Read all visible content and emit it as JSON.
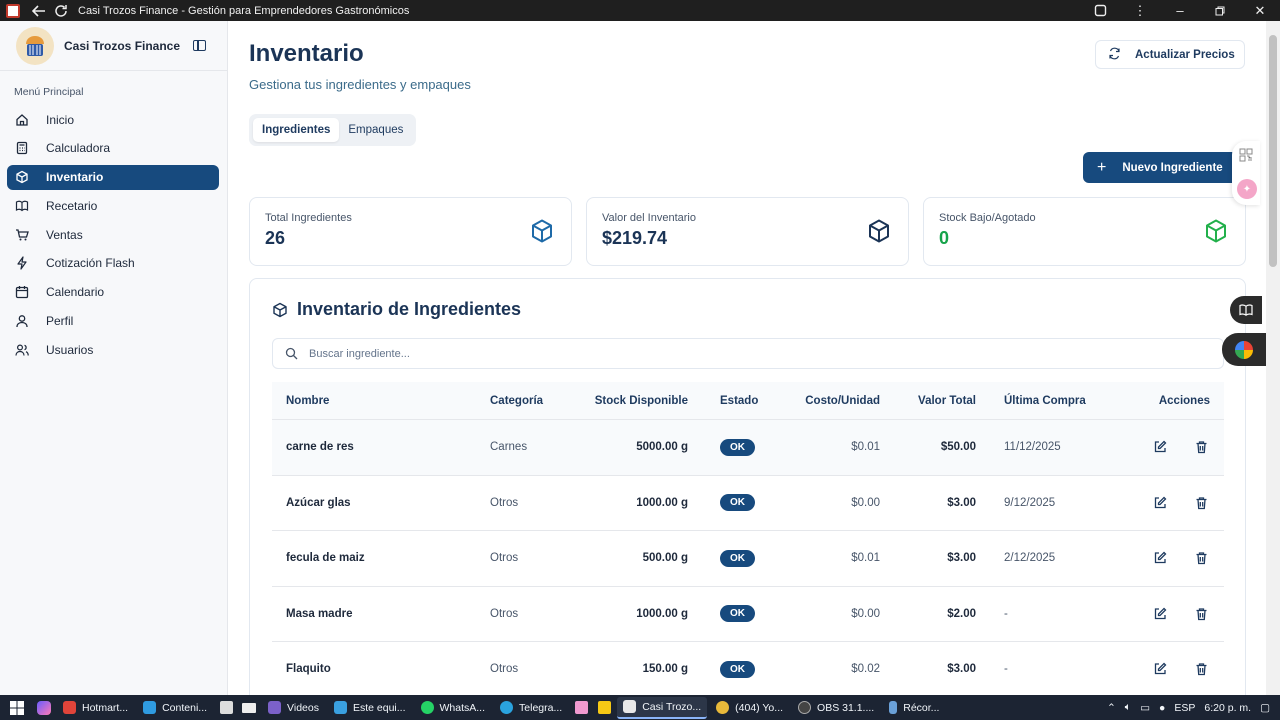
{
  "window": {
    "title": "Casi Trozos Finance - Gestión para Emprendedores Gastronómicos"
  },
  "sidebar": {
    "brand": "Casi Trozos Finance",
    "menu_label": "Menú Principal",
    "items": [
      {
        "label": "Inicio",
        "icon": "home-icon"
      },
      {
        "label": "Calculadora",
        "icon": "calculator-icon"
      },
      {
        "label": "Inventario",
        "icon": "package-icon",
        "active": true
      },
      {
        "label": "Recetario",
        "icon": "book-icon"
      },
      {
        "label": "Ventas",
        "icon": "cart-icon"
      },
      {
        "label": "Cotización Flash",
        "icon": "zap-icon"
      },
      {
        "label": "Calendario",
        "icon": "calendar-icon"
      },
      {
        "label": "Perfil",
        "icon": "user-icon"
      },
      {
        "label": "Usuarios",
        "icon": "users-icon"
      }
    ]
  },
  "header": {
    "title": "Inventario",
    "subtitle": "Gestiona tus ingredientes y empaques",
    "refresh_label": "Actualizar Precios",
    "new_label": "Nuevo Ingrediente"
  },
  "tabs": [
    {
      "label": "Ingredientes",
      "active": true
    },
    {
      "label": "Empaques",
      "active": false
    }
  ],
  "stats": [
    {
      "label": "Total Ingredientes",
      "value": "26",
      "color": "#1b3456"
    },
    {
      "label": "Valor del Inventario",
      "value": "$219.74",
      "color": "#1b3456"
    },
    {
      "label": "Stock Bajo/Agotado",
      "value": "0",
      "color": "#16a34a"
    }
  ],
  "inventory": {
    "title": "Inventario de Ingredientes",
    "search_placeholder": "Buscar ingrediente...",
    "columns": [
      "Nombre",
      "Categoría",
      "Stock Disponible",
      "Estado",
      "Costo/Unidad",
      "Valor Total",
      "Última Compra",
      "Acciones"
    ],
    "rows": [
      {
        "nombre": "carne de res",
        "categoria": "Carnes",
        "stock": "5000.00 g",
        "estado": "OK",
        "costo": "$0.01",
        "valor": "$50.00",
        "fecha": "11/12/2025"
      },
      {
        "nombre": "Azúcar glas",
        "categoria": "Otros",
        "stock": "1000.00 g",
        "estado": "OK",
        "costo": "$0.00",
        "valor": "$3.00",
        "fecha": "9/12/2025"
      },
      {
        "nombre": "fecula de maiz",
        "categoria": "Otros",
        "stock": "500.00 g",
        "estado": "OK",
        "costo": "$0.01",
        "valor": "$3.00",
        "fecha": "2/12/2025"
      },
      {
        "nombre": "Masa madre",
        "categoria": "Otros",
        "stock": "1000.00 g",
        "estado": "OK",
        "costo": "$0.00",
        "valor": "$2.00",
        "fecha": "-"
      },
      {
        "nombre": "Flaquito",
        "categoria": "Otros",
        "stock": "150.00 g",
        "estado": "OK",
        "costo": "$0.02",
        "valor": "$3.00",
        "fecha": "-"
      }
    ]
  },
  "taskbar": {
    "items": [
      {
        "label": "Hotmart...",
        "color": "#e0443a"
      },
      {
        "label": "Conteni...",
        "color": "#2f9be0"
      },
      {
        "label": "Videos",
        "color": "#7b61c9"
      },
      {
        "label": "Este equi...",
        "color": "#3aa0e0"
      },
      {
        "label": "WhatsA...",
        "color": "#25d366"
      },
      {
        "label": "Telegra...",
        "color": "#2aa3df"
      },
      {
        "label": "Casi Trozo...",
        "color": "#e8e8e8",
        "open": true
      },
      {
        "label": "(404) Yo...",
        "color": "#e8b93a"
      },
      {
        "label": "OBS 31.1....",
        "color": "#444444"
      },
      {
        "label": "Récor...",
        "color": "#6aa0d8"
      }
    ],
    "lang": "ESP",
    "time": "6:20 p. m."
  }
}
